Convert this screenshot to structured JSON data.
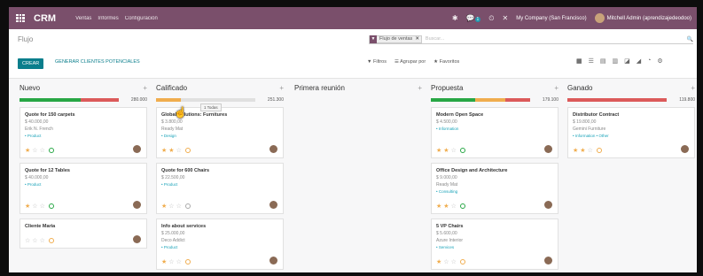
{
  "nav": {
    "brand": "CRM",
    "menu": [
      "Ventas",
      "Informes",
      "Configuración"
    ],
    "chat_badge": "1",
    "company": "My Company (San Francisco)",
    "user": "Mitchell Admin (aprendizajedeodoo)"
  },
  "control": {
    "breadcrumb": "Flujo",
    "facet_label": "Flujo de ventas",
    "search_placeholder": "Buscar...",
    "create": "CREAR",
    "generate": "GENERAR CLIENTES POTENCIALES",
    "filters": "Filtros",
    "group_by": "Agrupar por",
    "favorites": "Favoritos"
  },
  "columns": [
    {
      "name": "Nuevo",
      "total": "280.000",
      "bar": {
        "green": 0.62,
        "orange": 0.0,
        "red": 0.38
      },
      "cards": [
        {
          "title": "Quote for 150 carpets",
          "amount": "$ 40.000,00",
          "partner": "Erik N. French",
          "tag": "• Product",
          "stars": 1,
          "dot": "green"
        },
        {
          "title": "Quote for 12 Tables",
          "amount": "$ 40.000,00",
          "partner": "",
          "tag": "• Product",
          "stars": 1,
          "dot": "green"
        },
        {
          "title": "Cliente Maria",
          "amount": "",
          "partner": "",
          "tag": "",
          "stars": 0,
          "dot": "orange"
        }
      ]
    },
    {
      "name": "Calificado",
      "total": "251.300",
      "tooltip": "1 Todas",
      "bar": {
        "green": 0.0,
        "orange": 0.25,
        "red": 0.0
      },
      "cards": [
        {
          "title": "Global Solutions: Furnitures",
          "amount": "$ 3.800,00",
          "partner": "Ready Mat",
          "tag": "• Design",
          "stars": 2,
          "dot": "orange"
        },
        {
          "title": "Quote for 600 Chairs",
          "amount": "$ 22.500,00",
          "partner": "",
          "tag": "• Product",
          "stars": 1,
          "dot": "grey"
        },
        {
          "title": "Info about services",
          "amount": "$ 25.000,00",
          "partner": "Deco Addict",
          "tag": "• Product",
          "stars": 1,
          "dot": "orange"
        }
      ]
    },
    {
      "name": "Primera reunión",
      "total": "",
      "bar": {
        "green": 0.0,
        "orange": 0.0,
        "red": 0.0
      },
      "cards": []
    },
    {
      "name": "Propuesta",
      "total": "179.100",
      "bar": {
        "green": 0.45,
        "orange": 0.3,
        "red": 0.25
      },
      "cards": [
        {
          "title": "Modern Open Space",
          "amount": "$ 4.500,00",
          "partner": "",
          "tag": "• Information",
          "stars": 2,
          "dot": "green"
        },
        {
          "title": "Office Design and Architecture",
          "amount": "$ 9.000,00",
          "partner": "Ready Mat",
          "tag": "• Consulting",
          "stars": 2,
          "dot": "green"
        },
        {
          "title": "5 VP Chairs",
          "amount": "$ 5.600,00",
          "partner": "Azure Interior",
          "tag": "• Services",
          "stars": 1,
          "dot": "orange"
        }
      ]
    },
    {
      "name": "Ganado",
      "total": "119.800",
      "bar": {
        "green": 0.0,
        "orange": 0.0,
        "red": 1.0
      },
      "cards": [
        {
          "title": "Distributor Contract",
          "amount": "$ 19.800,00",
          "partner": "Gemini Furniture",
          "tag": "• Information • Other",
          "stars": 2,
          "dot": "orange"
        }
      ]
    }
  ],
  "colors": {
    "navbar": "#7a4f6b",
    "accent": "#0a7e8c",
    "green": "#28a745",
    "red": "#dc5a5a",
    "orange": "#f0ad4e"
  }
}
